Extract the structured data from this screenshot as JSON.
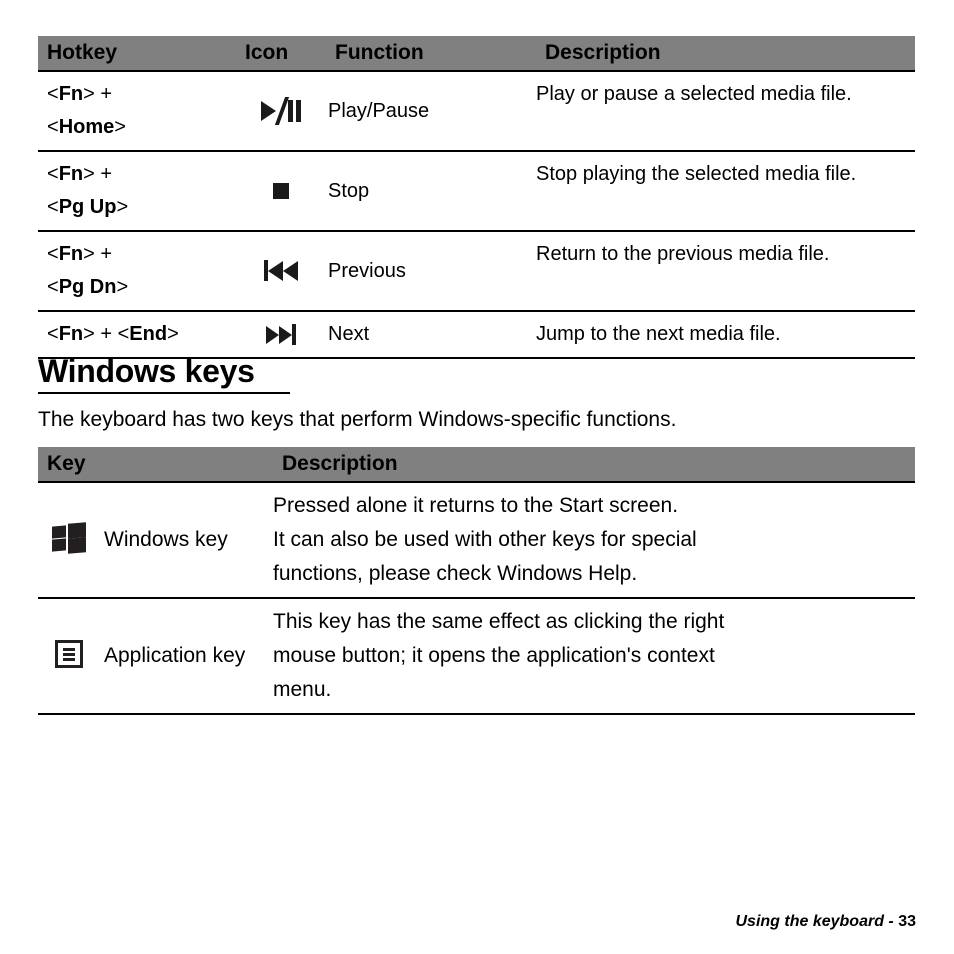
{
  "document": {
    "footer": {
      "section_label": "Using the keyboard",
      "separator": "-",
      "page_number": "33"
    }
  },
  "hotkey_table": {
    "headers": {
      "hotkey": "Hotkey",
      "icon": "Icon",
      "function": "Function",
      "description": "Description"
    },
    "rows": [
      {
        "hotkey_line1_pre": "<",
        "hotkey_line1_key": "Fn",
        "hotkey_line1_post": "> + ",
        "hotkey_line2_pre": "<",
        "hotkey_line2_key": "Home",
        "hotkey_line2_post": ">",
        "icon_name": "play-pause-icon",
        "function": "Play/Pause",
        "description": "Play or pause a selected media file."
      },
      {
        "hotkey_line1_pre": "<",
        "hotkey_line1_key": "Fn",
        "hotkey_line1_post": "> + ",
        "hotkey_line2_pre": "<",
        "hotkey_line2_key": "Pg Up",
        "hotkey_line2_post": ">",
        "icon_name": "stop-icon",
        "function": "Stop",
        "description": "Stop playing the selected media file."
      },
      {
        "hotkey_line1_pre": "<",
        "hotkey_line1_key": "Fn",
        "hotkey_line1_post": "> + ",
        "hotkey_line2_pre": "<",
        "hotkey_line2_key": "Pg Dn",
        "hotkey_line2_post": ">",
        "icon_name": "previous-track-icon",
        "function": "Previous",
        "description": "Return to the previous media file."
      },
      {
        "hotkey_line1_pre": "<",
        "hotkey_line1_key": "Fn",
        "hotkey_line1_post": "> + <",
        "hotkey_line2_pre": "",
        "hotkey_line2_key": "End",
        "hotkey_line2_post": ">",
        "icon_name": "next-track-icon",
        "function": "Next",
        "description": "Jump to the next media file."
      }
    ]
  },
  "windows_keys_section": {
    "heading": "Windows keys",
    "intro": "The keyboard has two keys that perform Windows-specific functions.",
    "table": {
      "headers": {
        "key": "Key",
        "description": "Description"
      },
      "rows": [
        {
          "icon_name": "windows-logo-icon",
          "key_name": "Windows key",
          "description_lines": [
            "Pressed alone it returns to the Start screen.",
            "It can also be used with other keys for special",
            "functions, please check Windows Help."
          ]
        },
        {
          "icon_name": "application-key-icon",
          "key_name": "Application key",
          "description_lines": [
            "This key has the same effect as clicking the right",
            "mouse button; it opens the application's context",
            "menu."
          ]
        }
      ]
    }
  },
  "colors": {
    "table_header_background": "#808080",
    "text": "#000000",
    "icon": "#231f20",
    "rule": "#000000"
  }
}
